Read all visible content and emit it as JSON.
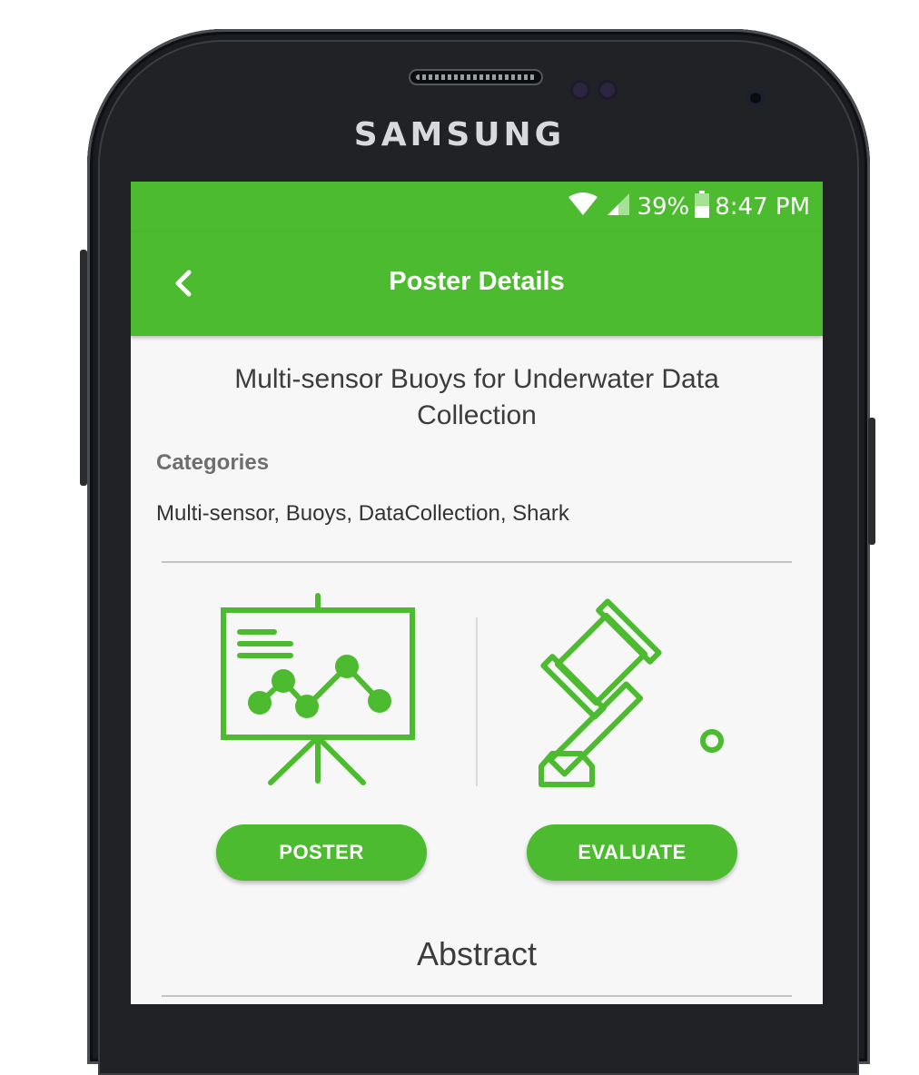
{
  "device": {
    "brand": "SAMSUNG"
  },
  "status_bar": {
    "battery": "39%",
    "time": "8:47 PM"
  },
  "app_bar": {
    "title": "Poster Details"
  },
  "poster": {
    "title": "Multi-sensor Buoys for Underwater Data Collection",
    "categories_heading": "Categories",
    "categories": "Multi-sensor, Buoys, DataCollection, Shark"
  },
  "actions": {
    "poster_label": "POSTER",
    "evaluate_label": "EVALUATE"
  },
  "abstract": {
    "heading": "Abstract"
  },
  "colors": {
    "accent": "#4cbb2f",
    "text_dark": "#3c3c3c",
    "text_muted": "#6e6e6e"
  },
  "icons": [
    "wifi-icon",
    "signal-icon",
    "battery-icon",
    "back-arrow-icon",
    "presentation-board-icon",
    "gavel-icon"
  ]
}
